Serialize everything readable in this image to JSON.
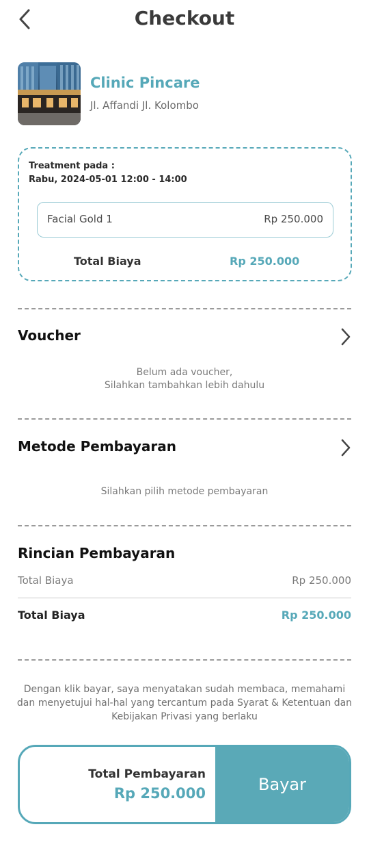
{
  "header": {
    "title": "Checkout"
  },
  "clinic": {
    "name": "Clinic Pincare",
    "address": "Jl. Affandi Jl. Kolombo"
  },
  "treatment": {
    "label": "Treatment pada :",
    "schedule": "Rabu, 2024-05-01 12:00 - 14:00",
    "service_name": "Facial Gold 1",
    "service_price": "Rp 250.000",
    "total_label": "Total Biaya",
    "total_value": "Rp 250.000"
  },
  "voucher": {
    "title": "Voucher",
    "hint_line1": "Belum ada voucher,",
    "hint_line2": "Silahkan tambahkan lebih dahulu"
  },
  "payment_method": {
    "title": "Metode Pembayaran",
    "hint": "Silahkan pilih metode pembayaran"
  },
  "rincian": {
    "title": "Rincian Pembayaran",
    "subtotal_label": "Total Biaya",
    "subtotal_value": "Rp 250.000",
    "total_label": "Total Biaya",
    "total_value": "Rp 250.000"
  },
  "terms": "Dengan klik bayar, saya menyatakan sudah membaca, memahami dan menyetujui hal-hal yang tercantum pada Syarat & Ketentuan dan Kebijakan Privasi yang berlaku",
  "pay_bar": {
    "label": "Total Pembayaran",
    "amount": "Rp 250.000",
    "button_label": "Bayar"
  },
  "colors": {
    "accent": "#56a8b8",
    "button": "#5aa9b7"
  },
  "icons": {
    "back": "chevron-left-icon",
    "voucher_open": "chevron-right-icon",
    "payment_open": "chevron-right-icon"
  }
}
